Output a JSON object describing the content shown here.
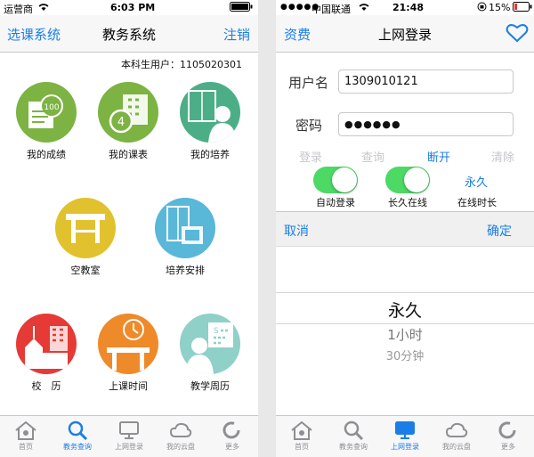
{
  "left": {
    "status": {
      "carrier": "运营商",
      "time": "6:03 PM"
    },
    "nav": {
      "left": "选课系统",
      "title": "教务系统",
      "right": "注销"
    },
    "user": "本科生用户：1105020301",
    "tiles": [
      {
        "label": "我的成绩",
        "color": "#7cb342",
        "icon": "score-icon"
      },
      {
        "label": "我的课表",
        "color": "#7cb342",
        "icon": "timetable-icon"
      },
      {
        "label": "我的培养",
        "color": "#4cae87",
        "icon": "training-icon"
      },
      {
        "label": "空教室",
        "color": "#e1c22e",
        "icon": "empty-classroom-icon"
      },
      {
        "label": "培养安排",
        "color": "#59b7d8",
        "icon": "schedule-plan-icon"
      },
      {
        "label": "校　历",
        "color": "#e53a35",
        "icon": "calendar-icon"
      },
      {
        "label": "上课时间",
        "color": "#ef8a2a",
        "icon": "class-time-icon"
      },
      {
        "label": "教学周历",
        "color": "#8fd0c8",
        "icon": "teaching-week-icon"
      }
    ],
    "tabs": [
      {
        "label": "首页",
        "icon": "home-icon",
        "active": false
      },
      {
        "label": "教务查询",
        "icon": "search-icon",
        "active": true
      },
      {
        "label": "上网登录",
        "icon": "monitor-icon",
        "active": false
      },
      {
        "label": "我的云盘",
        "icon": "cloud-icon",
        "active": false
      },
      {
        "label": "更多",
        "icon": "more-icon",
        "active": false
      }
    ]
  },
  "right": {
    "status": {
      "carrier": "中国联通",
      "time": "21:48",
      "battery": "15%"
    },
    "nav": {
      "left": "资费",
      "title": "上网登录",
      "right_icon": "heart-icon"
    },
    "username_label": "用户名",
    "username_value": "1309010121",
    "password_label": "密码",
    "password_value": "●●●●●●",
    "actions": {
      "login": "登录",
      "query": "查询",
      "disconnect": "断开",
      "clear": "清除"
    },
    "toggles": {
      "auto_login": "自动登录",
      "stay_online": "长久在线",
      "duration_value": "永久",
      "duration_label": "在线时长"
    },
    "picker_bar": {
      "cancel": "取消",
      "confirm": "确定"
    },
    "picker_options": [
      "永久",
      "1小时",
      "30分钟"
    ],
    "tabs": [
      {
        "label": "首页",
        "icon": "home-icon",
        "active": false
      },
      {
        "label": "教务查询",
        "icon": "search-icon",
        "active": false
      },
      {
        "label": "上网登录",
        "icon": "monitor-icon",
        "active": true
      },
      {
        "label": "我的云盘",
        "icon": "cloud-icon",
        "active": false
      },
      {
        "label": "更多",
        "icon": "more-icon",
        "active": false
      }
    ],
    "colors": {
      "accent": "#1a7ee6",
      "toggle_on": "#4cd964"
    }
  }
}
